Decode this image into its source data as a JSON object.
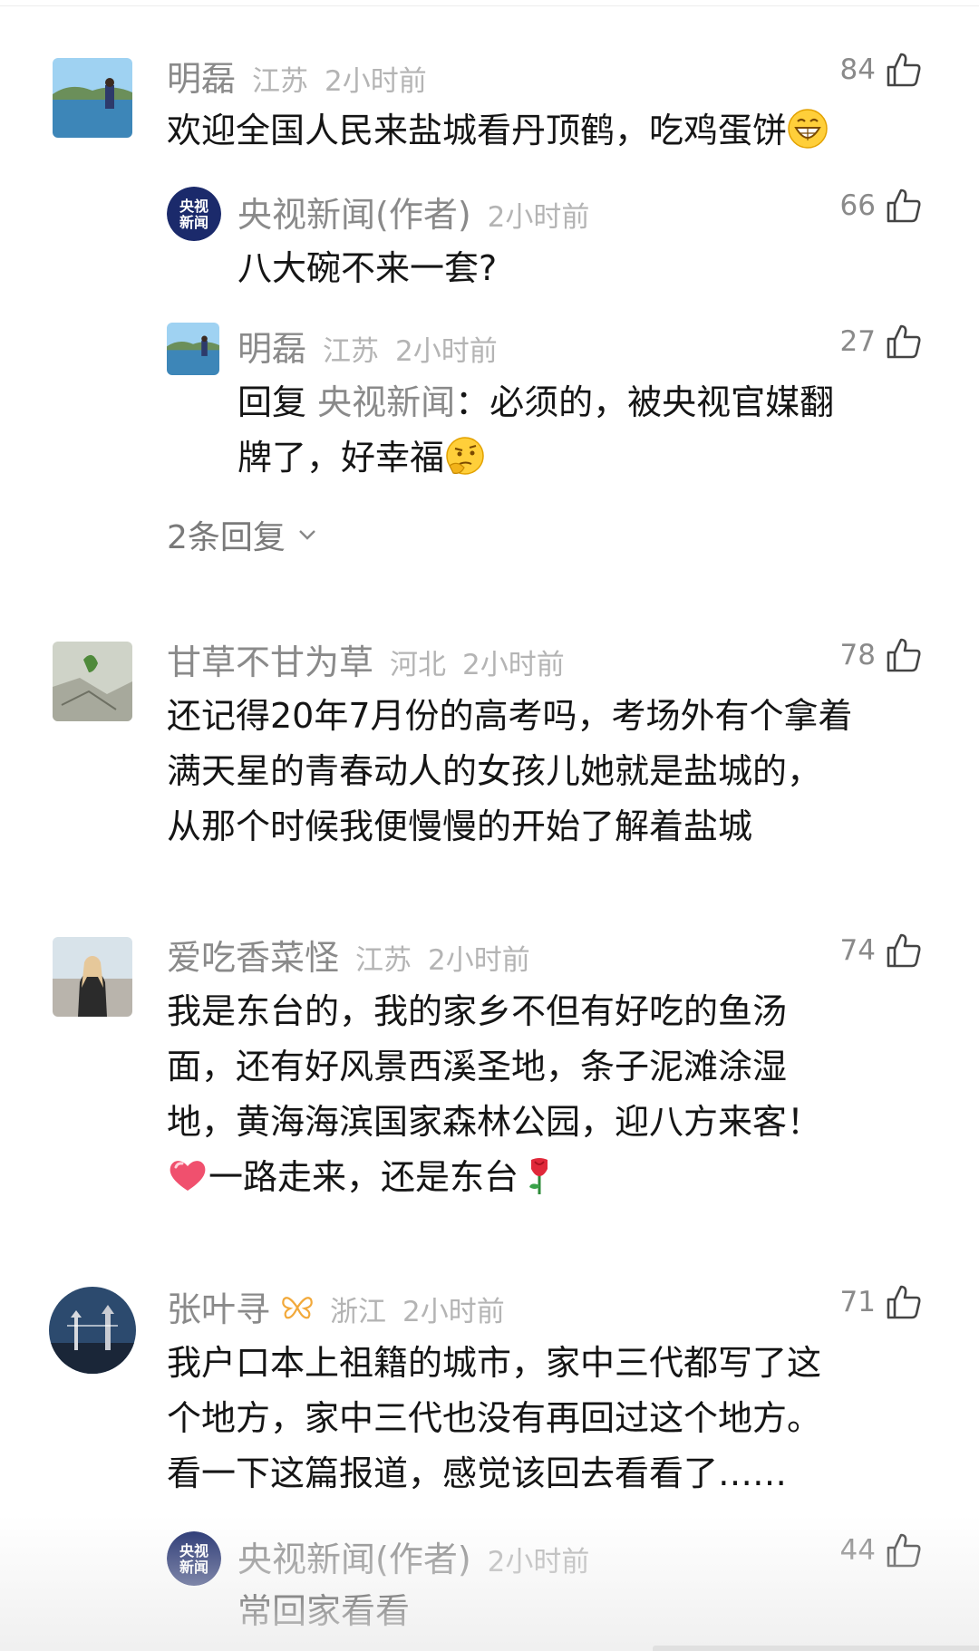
{
  "comments": [
    {
      "name": "明磊",
      "location": "江苏",
      "time": "2小时前",
      "likes": "84",
      "lines": [
        "欢迎全国人民来盐城看丹顶鹤，吃鸡蛋饼"
      ],
      "emoji": "grinning-emoji",
      "replies": [
        {
          "name": "央视新闻(作者)",
          "time": "2小时前",
          "likes": "66",
          "text": "八大碗不来一套?"
        },
        {
          "name": "明磊",
          "location": "江苏",
          "time": "2小时前",
          "likes": "27",
          "reply_prefix": "回复 ",
          "reply_target": "央视新闻",
          "reply_colon": "：",
          "line1": "必须的，被央视官媒翻",
          "line2": "牌了，好幸福",
          "emoji": "thinking-emoji"
        }
      ],
      "more_replies": "2条回复"
    },
    {
      "name": "甘草不甘为草",
      "location": "河北",
      "time": "2小时前",
      "likes": "78",
      "lines": [
        "还记得20年7月份的高考吗，考场外有个拿着",
        "满天星的青春动人的女孩儿她就是盐城的，",
        "从那个时候我便慢慢的开始了解着盐城"
      ]
    },
    {
      "name": "爱吃香菜怪",
      "location": "江苏",
      "time": "2小时前",
      "likes": "74",
      "lines": [
        "我是东台的，我的家乡不但有好吃的鱼汤",
        "面，还有好风景西溪圣地，条子泥滩涂湿",
        "地，黄海海滨国家森林公园，迎八方来客！"
      ],
      "last_line": "一路走来，还是东台",
      "emojis": [
        "heart-emoji",
        "rose-emoji"
      ]
    },
    {
      "name": "张叶寻",
      "badge": "butterfly-icon",
      "location": "浙江",
      "time": "2小时前",
      "likes": "71",
      "lines": [
        "我户口本上祖籍的城市，家中三代都写了这",
        "个地方，家中三代也没有再回过这个地方。",
        "看一下这篇报道，感觉该回去看看了……"
      ],
      "replies": [
        {
          "name": "央视新闻(作者)",
          "time": "2小时前",
          "likes": "44",
          "text": "常回家看看"
        }
      ]
    }
  ],
  "cctv_logo": {
    "line1": "央视",
    "line2": "新闻"
  },
  "colors": {
    "name": "#8a8a8a",
    "meta": "#b4b4b4",
    "text": "#151515",
    "cctv_navy": "#1b2a6b"
  }
}
